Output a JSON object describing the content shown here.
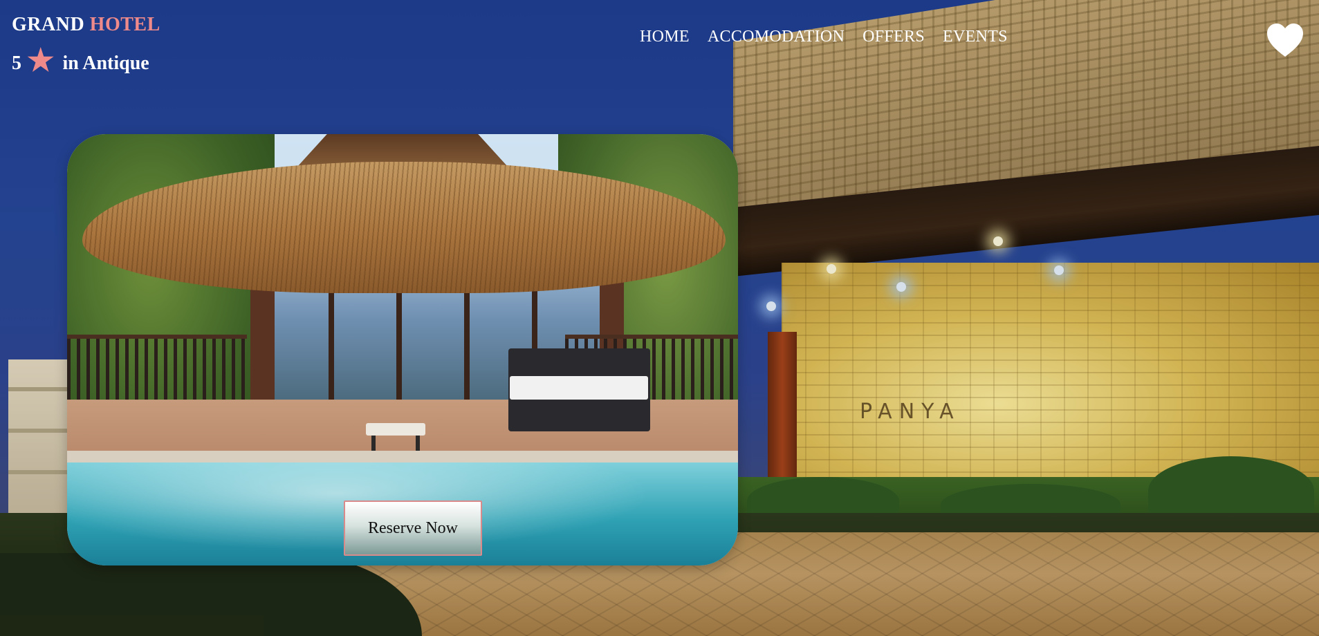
{
  "header": {
    "brand_primary": "GRAND",
    "brand_accent": "HOTEL",
    "rating_number": "5",
    "rating_icon": "star-icon",
    "rating_suffix": "in Antique",
    "favorite_icon": "heart-icon"
  },
  "nav": {
    "items": [
      {
        "label": "HOME"
      },
      {
        "label": "ACCOMODATION"
      },
      {
        "label": "OFFERS"
      },
      {
        "label": "EVENTS"
      }
    ]
  },
  "hero": {
    "sign_text": "PANYA",
    "reserve_label": "Reserve Now"
  },
  "colors": {
    "accent": "#ef8a8a",
    "text": "#ffffff",
    "sky": "#27489c"
  }
}
